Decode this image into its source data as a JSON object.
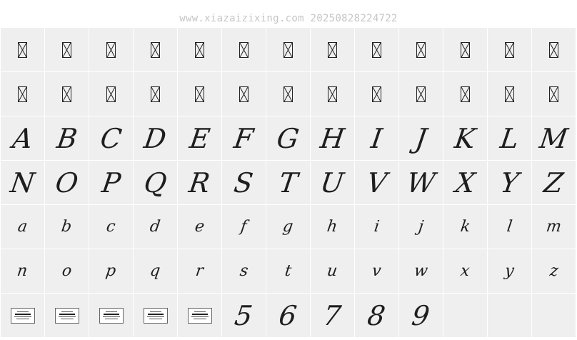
{
  "watermark": "www.xiazaizixing.com 20250828224722",
  "rows": [
    {
      "kind": "missing",
      "count": 13
    },
    {
      "kind": "missing",
      "count": 13
    },
    {
      "kind": "upper",
      "chars": [
        "A",
        "B",
        "C",
        "D",
        "E",
        "F",
        "G",
        "H",
        "I",
        "J",
        "K",
        "L",
        "M"
      ]
    },
    {
      "kind": "upper",
      "chars": [
        "N",
        "O",
        "P",
        "Q",
        "R",
        "S",
        "T",
        "U",
        "V",
        "W",
        "X",
        "Y",
        "Z"
      ]
    },
    {
      "kind": "lower",
      "chars": [
        "a",
        "b",
        "c",
        "d",
        "e",
        "f",
        "g",
        "h",
        "i",
        "j",
        "k",
        "l",
        "m"
      ]
    },
    {
      "kind": "lower",
      "chars": [
        "n",
        "o",
        "p",
        "q",
        "r",
        "s",
        "t",
        "u",
        "v",
        "w",
        "x",
        "y",
        "z"
      ]
    }
  ],
  "last_row": {
    "preview_count": 5,
    "digits": [
      "5",
      "6",
      "7",
      "8",
      "9"
    ],
    "empty_count": 3
  }
}
